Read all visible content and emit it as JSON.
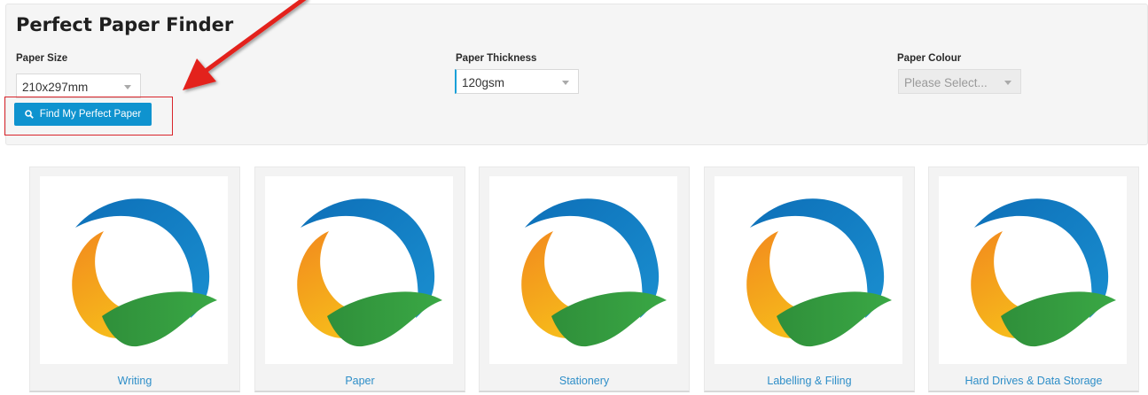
{
  "finder": {
    "title": "Perfect Paper Finder",
    "fields": [
      {
        "label": "Paper Size",
        "value": "210x297mm"
      },
      {
        "label": "Paper Thickness",
        "value": "120gsm"
      },
      {
        "label": "Paper Colour",
        "value": "Please Select..."
      }
    ],
    "button_label": "Find My Perfect Paper"
  },
  "categories": [
    {
      "label": "Writing"
    },
    {
      "label": "Paper"
    },
    {
      "label": "Stationery"
    },
    {
      "label": "Labelling & Filing"
    },
    {
      "label": "Hard Drives & Data Storage"
    }
  ],
  "colors": {
    "accent": "#0f93cf",
    "annotation": "#d9252b",
    "logo_blue": "#1a8fd0",
    "logo_orange": "#f2891e",
    "logo_yellow": "#f7c21a",
    "logo_green": "#3aa845"
  },
  "icons": [
    "search-icon",
    "chevron-down-icon",
    "logo-icon",
    "annotation-arrow-icon"
  ]
}
